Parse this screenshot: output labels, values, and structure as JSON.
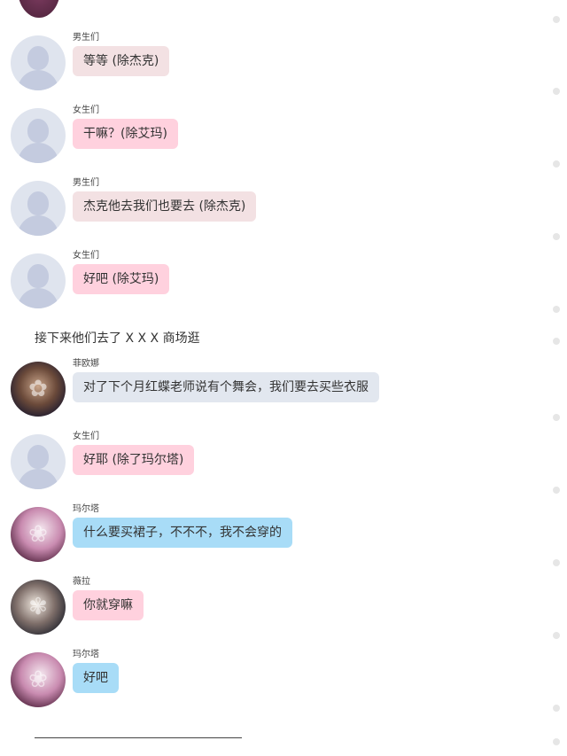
{
  "senders": {
    "boys": "男生们",
    "girls": "女生们",
    "feiou": "菲欧娜",
    "marta": "玛尔塔",
    "weila": "薇拉"
  },
  "messages": [
    {
      "sender": "男生们",
      "text": "等等 (除杰克)"
    },
    {
      "sender": "女生们",
      "text": "干嘛？(除艾玛)"
    },
    {
      "sender": "男生们",
      "text": "杰克他去我们也要去 (除杰克)"
    },
    {
      "sender": "女生们",
      "text": "好吧 (除艾玛)"
    },
    {
      "sender": "菲欧娜",
      "text": "对了下个月红蝶老师说有个舞会，我们要去买些衣服"
    },
    {
      "sender": "女生们",
      "text": "好耶 (除了玛尔塔)"
    },
    {
      "sender": "玛尔塔",
      "text": "什么要买裙子，不不不，我不会穿的"
    },
    {
      "sender": "薇拉",
      "text": "你就穿嘛"
    },
    {
      "sender": "玛尔塔",
      "text": "好吧"
    }
  ],
  "narration": "接下来他们去了 X X X 商场逛",
  "colors": {
    "boys_bubble": "#f3e1e3",
    "girls_bubble": "#ffd1de",
    "feiou_bubble": "#e2e7ef",
    "marta_bubble": "#a8dcf7",
    "placeholder_avatar": "#dfe4ee"
  }
}
